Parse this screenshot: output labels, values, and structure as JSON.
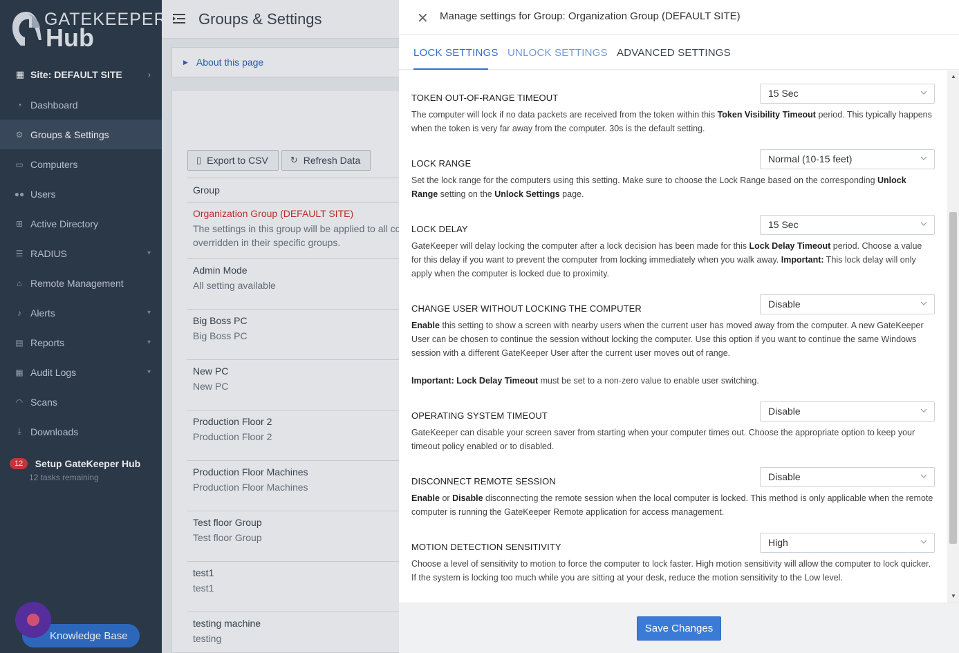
{
  "brand": {
    "top": "GATEKEEPER",
    "bottom": "Hub"
  },
  "sidebar": {
    "site": "Site: DEFAULT SITE",
    "items": [
      {
        "label": "Dashboard",
        "icon": "dashboard-icon"
      },
      {
        "label": "Groups & Settings",
        "icon": "cogs-icon",
        "active": true
      },
      {
        "label": "Computers",
        "icon": "monitor-icon"
      },
      {
        "label": "Users",
        "icon": "users-icon"
      },
      {
        "label": "Active Directory",
        "icon": "windows-icon"
      },
      {
        "label": "RADIUS",
        "icon": "server-icon",
        "expandable": true
      },
      {
        "label": "Remote Management",
        "icon": "home-icon"
      },
      {
        "label": "Alerts",
        "icon": "bell-icon",
        "expandable": true
      },
      {
        "label": "Reports",
        "icon": "file-icon",
        "expandable": true
      },
      {
        "label": "Audit Logs",
        "icon": "table-icon",
        "expandable": true
      },
      {
        "label": "Scans",
        "icon": "wifi-icon"
      },
      {
        "label": "Downloads",
        "icon": "download-icon"
      }
    ],
    "setup": {
      "badge": "12",
      "title": "Setup GateKeeper Hub",
      "subtitle": "12 tasks remaining"
    },
    "knowledge_base": "Knowledge Base"
  },
  "header": {
    "title": "Groups & Settings"
  },
  "about": {
    "label": "About this page"
  },
  "toolbar": {
    "export": "Export to CSV",
    "refresh": "Refresh Data"
  },
  "table": {
    "column": "Group",
    "rows": [
      {
        "name": "Organization Group (DEFAULT SITE)",
        "desc": "The settings in this group will be applied to all cor overridden in their specific groups.",
        "highlight": true
      },
      {
        "name": "Admin Mode",
        "desc": "All setting available"
      },
      {
        "name": "Big Boss PC",
        "desc": "Big Boss PC"
      },
      {
        "name": "New PC",
        "desc": "New PC"
      },
      {
        "name": "Production Floor 2",
        "desc": "Production Floor 2"
      },
      {
        "name": "Production Floor Machines",
        "desc": "Production Floor Machines"
      },
      {
        "name": "Test floor Group",
        "desc": "Test floor Group"
      },
      {
        "name": "test1",
        "desc": "test1"
      },
      {
        "name": "testing machine",
        "desc": "testing"
      }
    ]
  },
  "modal": {
    "title": "Manage settings for Group: Organization Group (DEFAULT SITE)",
    "tabs": [
      "LOCK SETTINGS",
      "UNLOCK SETTINGS",
      "ADVANCED SETTINGS"
    ],
    "active_tab": 0,
    "save": "Save Changes",
    "settings": {
      "token_timeout": {
        "label": "TOKEN OUT-OF-RANGE TIMEOUT",
        "value": "15 Sec",
        "d1": "The computer will lock if no data packets are received from the token within this ",
        "b1": "Token Visibility Timeout",
        "d2": " period. This typically happens when the token is very far away from the computer. 30s is the default setting."
      },
      "lock_range": {
        "label": "LOCK RANGE",
        "value": "Normal (10-15 feet)",
        "d1": "Set the lock range for the computers using this setting. Make sure to choose the Lock Range based on the corresponding ",
        "b1": "Unlock Range",
        "d2": " setting on the ",
        "b2": "Unlock Settings",
        "d3": " page."
      },
      "lock_delay": {
        "label": "LOCK DELAY",
        "value": "15 Sec",
        "d1": "GateKeeper will delay locking the computer after a lock decision has been made for this ",
        "b1": "Lock Delay Timeout",
        "d2": " period. Choose a value for this delay if you want to prevent the computer from locking immediately when you walk away. ",
        "b2": "Important:",
        "d3": " This lock delay will only apply when the computer is locked due to proximity."
      },
      "change_user": {
        "label": "CHANGE USER WITHOUT LOCKING THE COMPUTER",
        "value": "Disable",
        "b1": "Enable",
        "d1": " this setting to show a screen with nearby users when the current user has moved away from the computer. A new GateKeeper User can be chosen to continue the session without locking the computer. Use this option if you want to continue the same Windows session with a different GateKeeper User after the current user moves out of range.",
        "b2": "Important: Lock Delay Timeout",
        "d2": " must be set to a non-zero value to enable user switching."
      },
      "os_timeout": {
        "label": "OPERATING SYSTEM TIMEOUT",
        "value": "Disable",
        "d1": "GateKeeper can disable your screen saver from starting when your computer times out. Choose the appropriate option to keep your timeout policy enabled or to disabled."
      },
      "disconnect_remote": {
        "label": "DISCONNECT REMOTE SESSION",
        "value": "Disable",
        "b1": "Enable",
        "d1": " or ",
        "b2": "Disable",
        "d2": " disconnecting the remote session when the local computer is locked. This method is only applicable when the remote computer is running the GateKeeper Remote application for access management."
      },
      "motion": {
        "label": "MOTION DETECTION SENSITIVITY",
        "value": "High",
        "d1": "Choose a level of sensitivity to motion to force the computer to lock faster. High motion sensitivity will allow the computer to lock quicker. If the system is locking too much while you are sitting at your desk, reduce the motion sensitivity to the Low level."
      }
    }
  }
}
